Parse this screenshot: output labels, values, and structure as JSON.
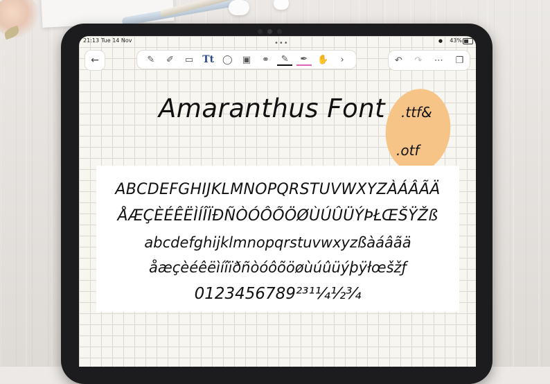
{
  "status_bar": {
    "time": "21:13",
    "date": "Tue 14 Nov",
    "battery": "43%"
  },
  "toolbar": {
    "back_icon": "back-arrow-icon",
    "tools": [
      "pencil-icon",
      "marker-icon",
      "eraser-icon",
      "text-icon",
      "lasso-icon",
      "image-icon",
      "microphone-icon",
      "pen-icon",
      "highlighter-icon",
      "hand-icon",
      "chevron-right-icon"
    ],
    "text_tool_label": "Tt",
    "right_tools": [
      "undo-icon",
      "redo-icon",
      "more-icon",
      "pages-icon"
    ]
  },
  "colors": {
    "pen_black": "#111111",
    "pen_pink": "#e063b4",
    "blob": "#f7c488"
  },
  "page": {
    "heading": "Amaranthus Font",
    "format_1": ".ttf&",
    "format_2": ".otf",
    "sample_lines": [
      "ABCDEFGHIJKLMNOPQRSTUVWXYZÀÁÂÃÄ",
      "ÅÆÇÈÉÊËÌÍÎÏÐÑÒÓÔÕÖØÙÚÛÜÝÞŁŒŠŸŽß",
      "abcdefghijklmnopqrstuvwxyzßàáâãä",
      "åæçèéêëìíîïðñòóôõöøùúûüýþÿłœšžƒ",
      "0123456789²³¹¼½¾"
    ]
  }
}
